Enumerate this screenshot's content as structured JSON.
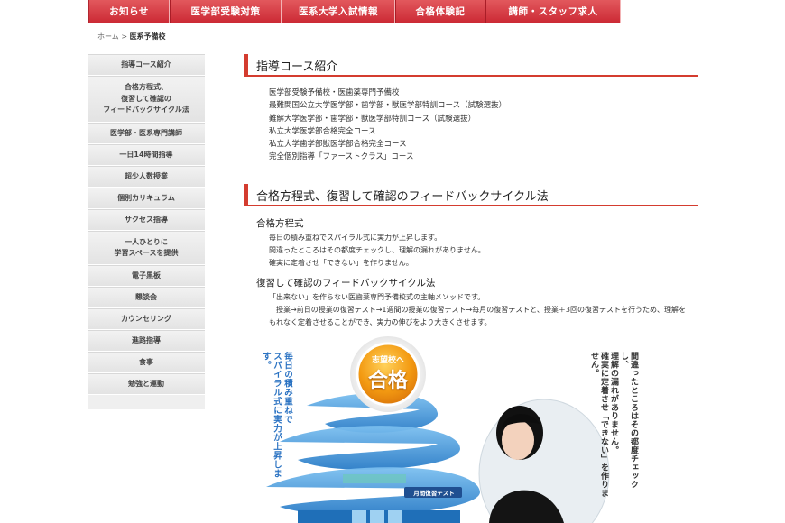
{
  "nav": {
    "items": [
      "お知らせ",
      "医学部受験対策",
      "医系大学入試情報",
      "合格体験記",
      "講師・スタッフ求人"
    ]
  },
  "breadcrumb": {
    "home": "ホーム",
    "sep": ">",
    "current": "医系予備校"
  },
  "sidebar": {
    "items": [
      {
        "lines": [
          "指導コース紹介"
        ]
      },
      {
        "lines": [
          "合格方程式、",
          "復習して確認の",
          "フィードバックサイクル法"
        ]
      },
      {
        "lines": [
          "医学部・医系専門講師"
        ]
      },
      {
        "lines": [
          "一日14時間指導"
        ]
      },
      {
        "lines": [
          "超少人数授業"
        ]
      },
      {
        "lines": [
          "個別カリキュラム"
        ]
      },
      {
        "lines": [
          "サクセス指導"
        ]
      },
      {
        "lines": [
          "一人ひとりに",
          "学習スペースを提供"
        ]
      },
      {
        "lines": [
          "電子黒板"
        ]
      },
      {
        "lines": [
          "懇談会"
        ]
      },
      {
        "lines": [
          "カウンセリング"
        ]
      },
      {
        "lines": [
          "進路指導"
        ]
      },
      {
        "lines": [
          "食事"
        ]
      },
      {
        "lines": [
          "勉強と運動"
        ]
      }
    ]
  },
  "courses": {
    "title": "指導コース紹介",
    "items": [
      "医学部受験予備校・医歯薬専門予備校",
      "最難関国公立大学医学部・歯学部・獣医学部特訓コース（試験選抜）",
      "難解大学医学部・歯学部・獣医学部特訓コース（試験選抜）",
      "私立大学医学部合格完全コース",
      "私立大学歯学部獣医学部合格完全コース",
      "完全個別指導「ファーストクラス」コース"
    ]
  },
  "feedback": {
    "title": "合格方程式、復習して確認のフィードバックサイクル法",
    "formula": {
      "heading": "合格方程式",
      "lines": [
        "毎日の積み重ねでスパイラル式に実力が上昇します。",
        "間違ったところはその都度チェックし、理解の漏れがありません。",
        "確実に定着させ「できない」を作りません。"
      ]
    },
    "cycle": {
      "heading": "復習して確認のフィードバックサイクル法",
      "line1": "「出来ない」を作らない医歯薬専門予備校式の主軸メソッドです。",
      "line2": "　授業→前日の授業の復習テスト→1週間の授業の復習テスト→毎月の復習テストと、授業＋3回の復習テストを行うため、理解をもれなく定着させることができ、実力の伸びをより大きくさせます。"
    }
  },
  "illustration": {
    "badge_top": "志望校へ",
    "badge_main": "合格",
    "left_vertical": [
      "毎日の積み重ねで",
      "スパイラル式に実力が上昇します。"
    ],
    "right_vertical": [
      "間違ったところはその都度チェックし、",
      "理解の漏れがありません。",
      "確実に定着させ「できない」を作りません。"
    ],
    "monthly_label": "月間復習テスト",
    "colors": {
      "ribbon": "#3b8fd6",
      "badge": "#f39a12",
      "accent": "#d43c2f"
    }
  }
}
